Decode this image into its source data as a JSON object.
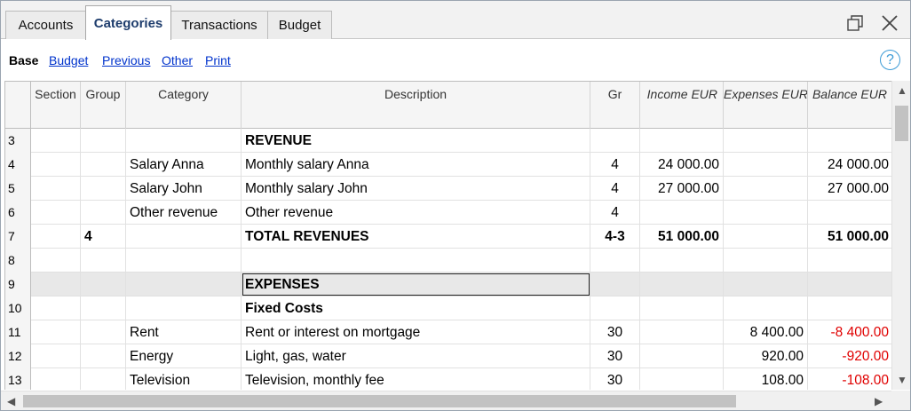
{
  "tabs": [
    "Accounts",
    "Categories",
    "Transactions",
    "Budget"
  ],
  "active_tab": "Categories",
  "window_controls": {
    "restore_icon": "restore-window-icon",
    "close_icon": "close-icon"
  },
  "views": {
    "base": "Base",
    "links": [
      "Budget",
      "Previous",
      "Other",
      "Print"
    ]
  },
  "help": {
    "icon": "help-icon",
    "glyph": "?"
  },
  "columns": [
    "Section",
    "Group",
    "Category",
    "Description",
    "Gr",
    "Income EUR",
    "Expenses EUR",
    "Balance EUR"
  ],
  "rows": [
    {
      "num": "3",
      "section": "",
      "group": "",
      "category": "",
      "description": "REVENUE",
      "gr": "",
      "income": "",
      "expenses": "",
      "balance": ""
    },
    {
      "num": "4",
      "section": "",
      "group": "",
      "category": "Salary Anna",
      "description": "Monthly salary Anna",
      "gr": "4",
      "income": "24 000.00",
      "expenses": "",
      "balance": "24 000.00"
    },
    {
      "num": "5",
      "section": "",
      "group": "",
      "category": "Salary John",
      "description": "Monthly salary John",
      "gr": "4",
      "income": "27 000.00",
      "expenses": "",
      "balance": "27 000.00"
    },
    {
      "num": "6",
      "section": "",
      "group": "",
      "category": "Other revenue",
      "description": "Other revenue",
      "gr": "4",
      "income": "",
      "expenses": "",
      "balance": ""
    },
    {
      "num": "7",
      "section": "",
      "group": "4",
      "category": "",
      "description": "TOTAL REVENUES",
      "gr": "4-3",
      "income": "51 000.00",
      "expenses": "",
      "balance": "51 000.00"
    },
    {
      "num": "8",
      "section": "",
      "group": "",
      "category": "",
      "description": "",
      "gr": "",
      "income": "",
      "expenses": "",
      "balance": ""
    },
    {
      "num": "9",
      "section": "",
      "group": "",
      "category": "",
      "description": "EXPENSES",
      "gr": "",
      "income": "",
      "expenses": "",
      "balance": ""
    },
    {
      "num": "10",
      "section": "",
      "group": "",
      "category": "",
      "description": "Fixed Costs",
      "gr": "",
      "income": "",
      "expenses": "",
      "balance": ""
    },
    {
      "num": "11",
      "section": "",
      "group": "",
      "category": "Rent",
      "description": "Rent or interest on mortgage",
      "gr": "30",
      "income": "",
      "expenses": "8 400.00",
      "balance": "-8 400.00"
    },
    {
      "num": "12",
      "section": "",
      "group": "",
      "category": "Energy",
      "description": "Light, gas, water",
      "gr": "30",
      "income": "",
      "expenses": "920.00",
      "balance": "-920.00"
    },
    {
      "num": "13",
      "section": "",
      "group": "",
      "category": "Television",
      "description": "Television, monthly fee",
      "gr": "30",
      "income": "",
      "expenses": "108.00",
      "balance": "-108.00"
    }
  ],
  "bold_rows": [
    "3",
    "7",
    "9",
    "10"
  ],
  "selected_row": "9",
  "colors": {
    "negative": "#e00000",
    "link": "#0033cc",
    "active_tab_text": "#1e3d6d",
    "help": "#3c9bd6"
  }
}
